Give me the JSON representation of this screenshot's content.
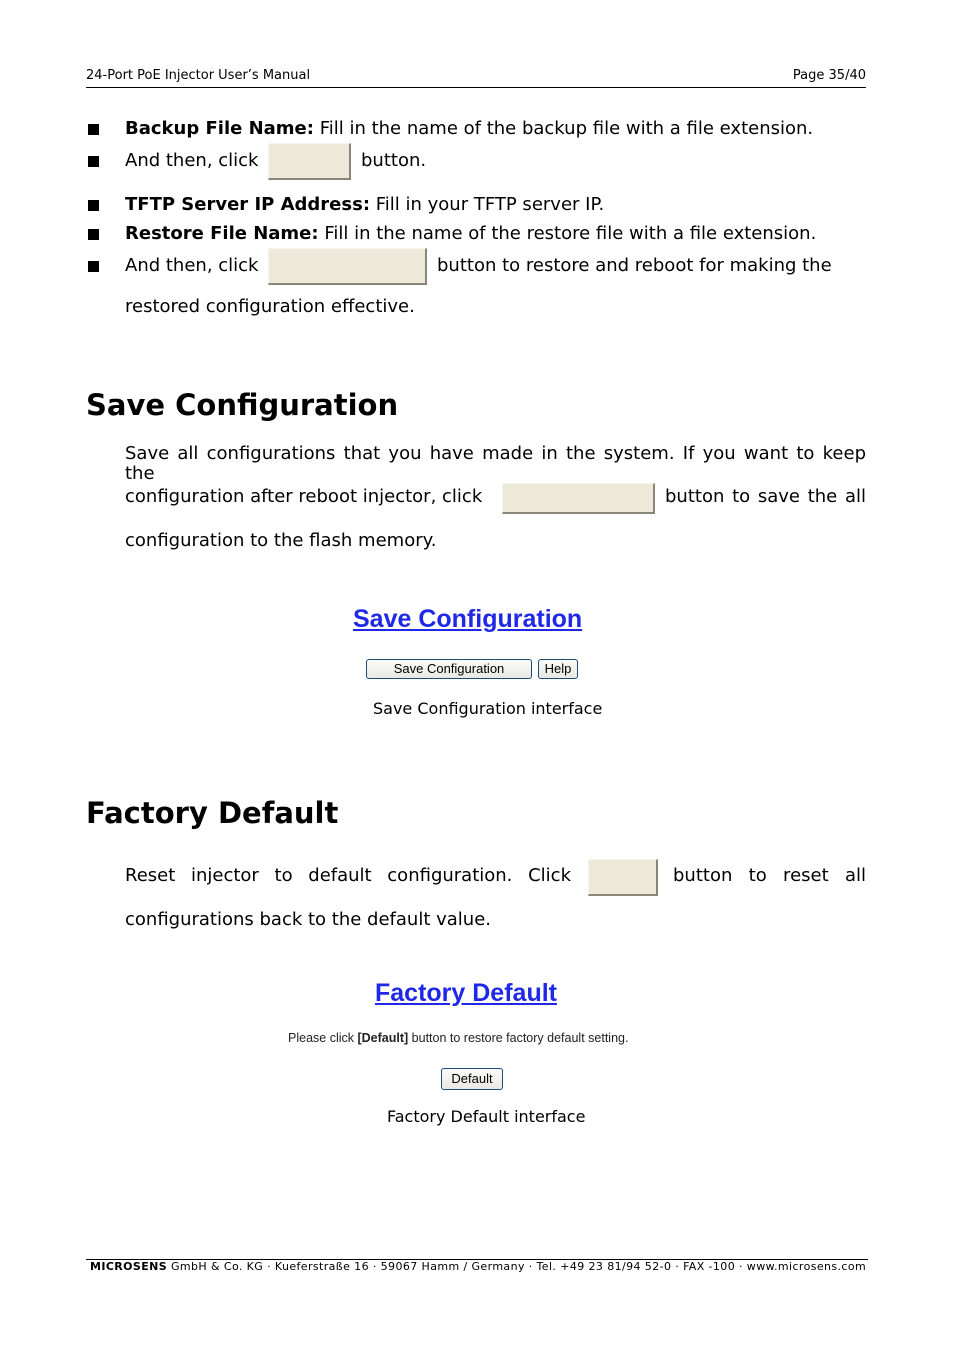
{
  "header": {
    "title": "24-Port PoE Injector User’s Manual",
    "page": "Page 35/40"
  },
  "bullets_top": [
    {
      "bold": "Backup File Name:",
      "text": " Fill in the name of the backup file with a file extension."
    },
    {
      "before": "And then, click",
      "after": "button."
    }
  ],
  "bullets_restore": [
    {
      "bold": "TFTP Server IP Address:",
      "text": " Fill in your TFTP server IP."
    },
    {
      "bold": "Restore File Name:",
      "text": " Fill in the name of the restore file with a file extension."
    },
    {
      "before": "And then, click",
      "after": "button to restore and reboot for making the",
      "continuation": "restored configuration effective."
    }
  ],
  "save_section": {
    "heading": "Save Configuration",
    "line1": "Save all configurations that you have made in the system. If you want to keep the",
    "line2_before": "configuration after reboot injector, click",
    "line2_after": "button to save the all",
    "line3": "configuration to the flash memory.",
    "interface": {
      "title": "Save Configuration",
      "save_button": "Save Configuration",
      "help_button": "Help",
      "caption": "Save Configuration interface"
    }
  },
  "factory_section": {
    "heading": "Factory Default",
    "line1_before": "Reset injector to default configuration. Click",
    "line1_after": "button to reset all",
    "line2": "configurations back to the default value.",
    "interface": {
      "title": "Factory Default",
      "instruction_before": "Please click ",
      "instruction_bold": "[Default]",
      "instruction_after": " button to restore factory default setting.",
      "default_button": "Default",
      "caption": "Factory Default interface"
    }
  },
  "footer": {
    "company": "MICROSENS",
    "text": " GmbH & Co. KG · Kueferstraße 16 · 59067 Hamm / Germany · Tel. +49 23 81/94 52-0 · FAX -100 · www.microsens.com"
  }
}
